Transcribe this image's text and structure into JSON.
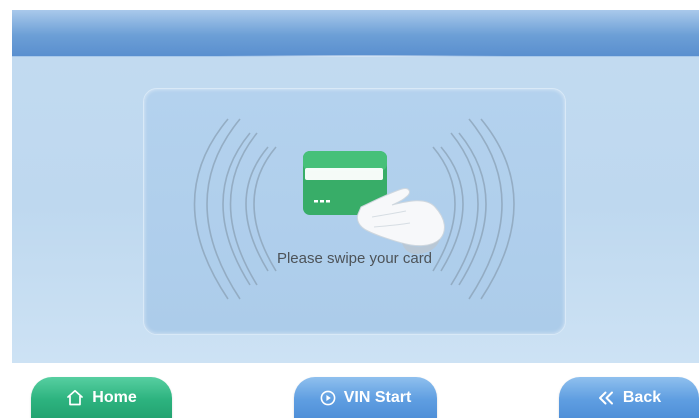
{
  "prompt": {
    "text": "Please swipe your card"
  },
  "buttons": {
    "home_label": "Home",
    "home_icon": "home-icon",
    "vin_label": "VIN Start",
    "vin_icon": "play-circle-icon",
    "back_label": "Back",
    "back_icon": "double-chevron-left-icon"
  },
  "colors": {
    "header": "#6c9fd6",
    "screen_bg": "#c3dbf1",
    "panel": "#b4d2ee",
    "card": "#39b06a",
    "home_button": "#2db37f",
    "nav_button": "#5f9ee1"
  }
}
